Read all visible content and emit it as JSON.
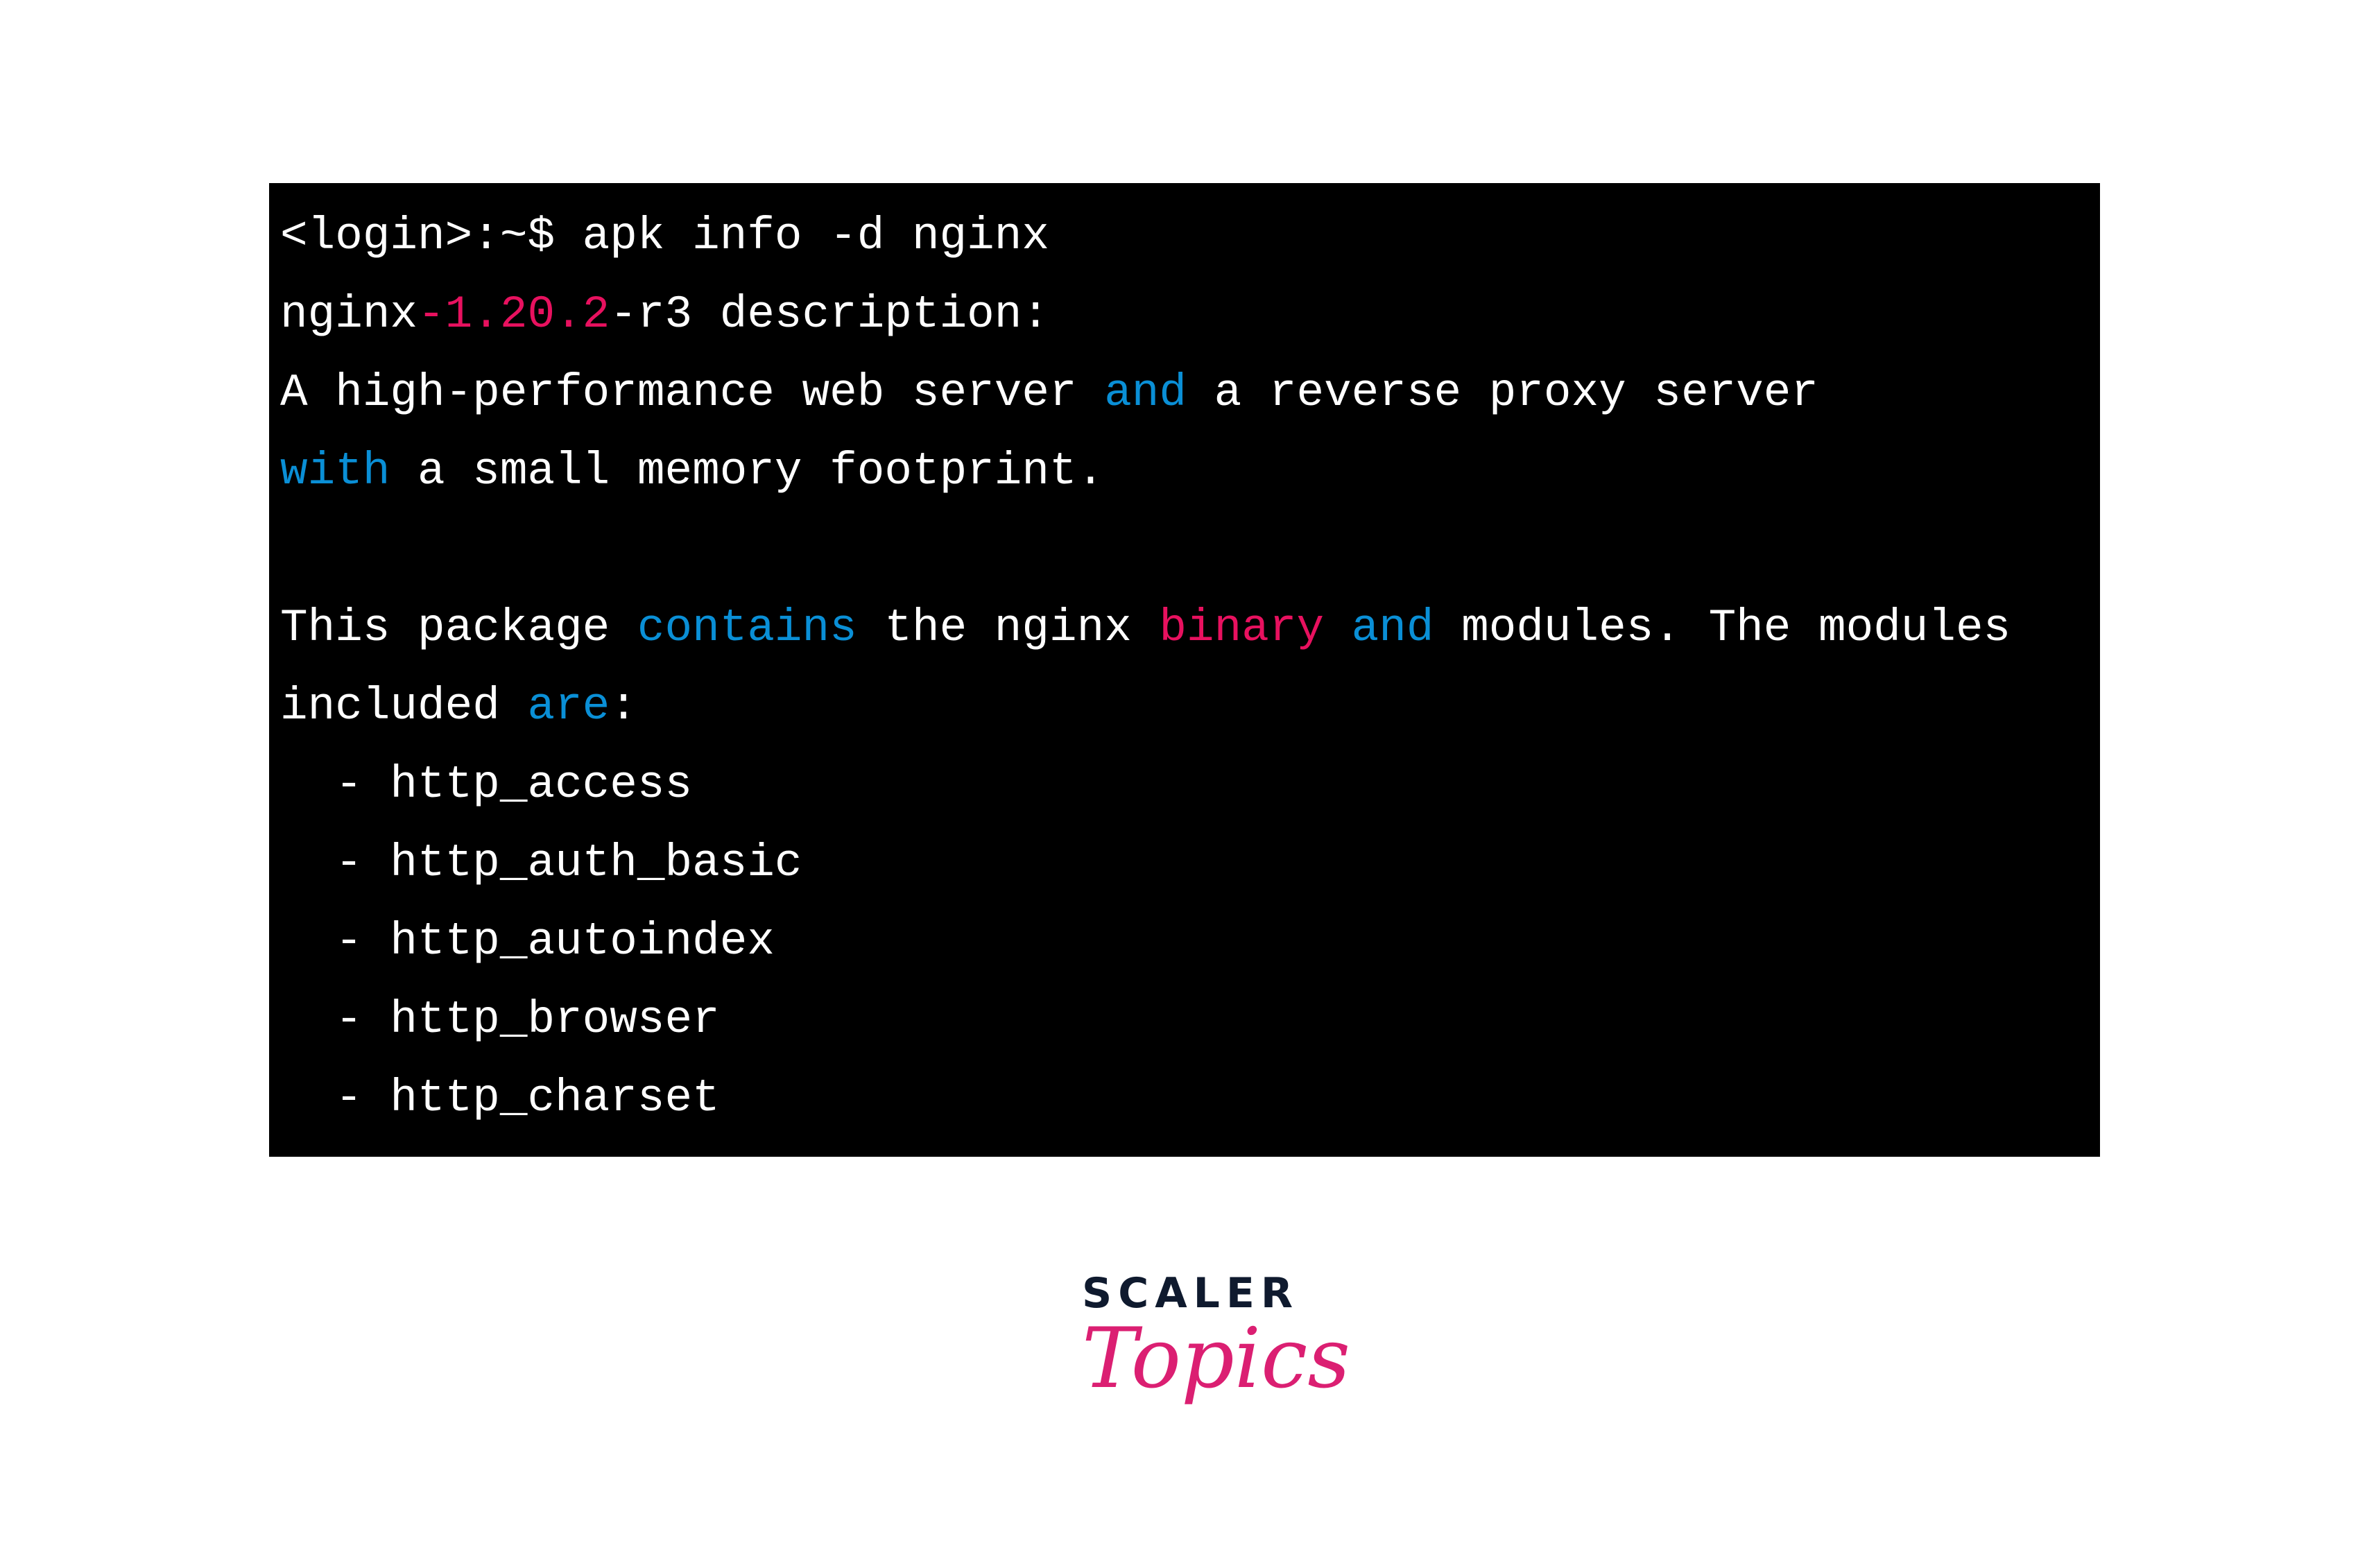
{
  "terminal": {
    "lines": [
      [
        {
          "t": "<login>:~$ apk info -d nginx",
          "c": "w"
        }
      ],
      [
        {
          "t": "nginx",
          "c": "w"
        },
        {
          "t": "-1.20.2",
          "c": "p"
        },
        {
          "t": "-r3 description:",
          "c": "w"
        }
      ],
      [
        {
          "t": "A high-performance web server ",
          "c": "w"
        },
        {
          "t": "and",
          "c": "b"
        },
        {
          "t": " a reverse proxy server",
          "c": "w"
        }
      ],
      [
        {
          "t": "with",
          "c": "b"
        },
        {
          "t": " a small memory footprint.",
          "c": "w"
        }
      ],
      [],
      [
        {
          "t": "This package ",
          "c": "w"
        },
        {
          "t": "contains",
          "c": "b"
        },
        {
          "t": " the nginx ",
          "c": "w"
        },
        {
          "t": "binary",
          "c": "p"
        },
        {
          "t": " ",
          "c": "w"
        },
        {
          "t": "and",
          "c": "b"
        },
        {
          "t": " modules. The modules",
          "c": "w"
        }
      ],
      [
        {
          "t": "included ",
          "c": "w"
        },
        {
          "t": "are",
          "c": "b"
        },
        {
          "t": ":",
          "c": "w"
        }
      ],
      [
        {
          "t": "  - http_access",
          "c": "w"
        }
      ],
      [
        {
          "t": "  - http_auth_basic",
          "c": "w"
        }
      ],
      [
        {
          "t": "  - http_autoindex",
          "c": "w"
        }
      ],
      [
        {
          "t": "  - http_browser",
          "c": "w"
        }
      ],
      [
        {
          "t": "  - http_charset",
          "c": "w"
        }
      ]
    ],
    "colors": {
      "text": "#ffffff",
      "keyword": "#0a8fd6",
      "highlight": "#e8115f",
      "background": "#000000"
    }
  },
  "logo": {
    "line1": "SCALER",
    "line2": "Topics",
    "colors": {
      "dark": "#0f1a2e",
      "pink": "#db1f72"
    }
  }
}
